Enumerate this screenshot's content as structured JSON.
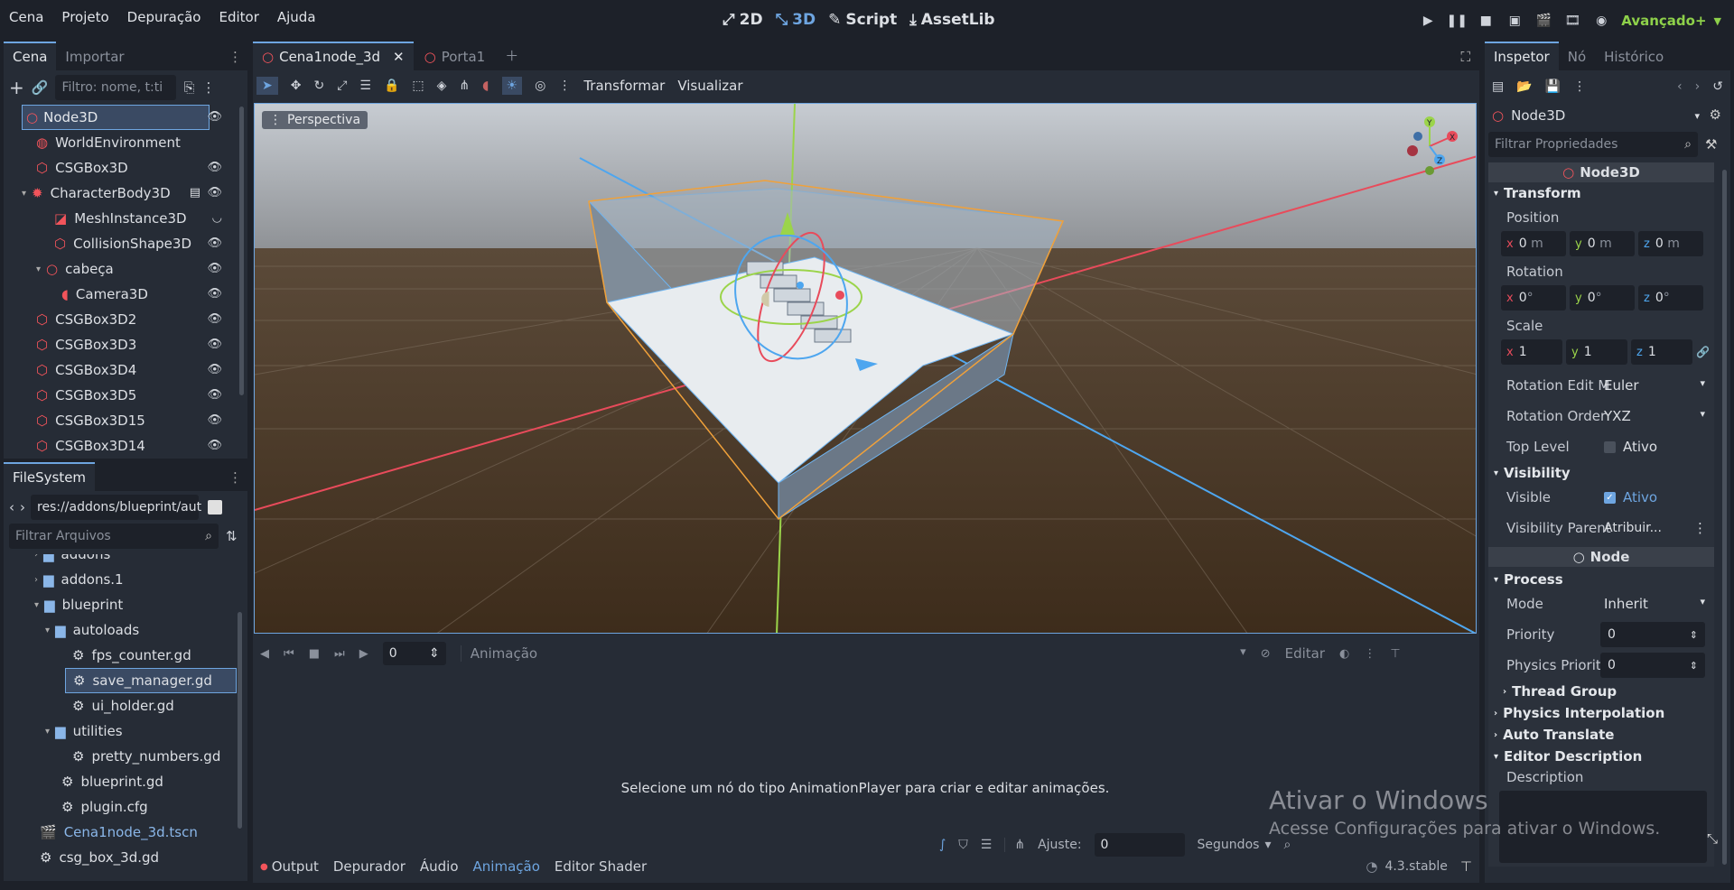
{
  "menu": [
    "Cena",
    "Projeto",
    "Depuração",
    "Editor",
    "Ajuda"
  ],
  "modes": [
    {
      "icon": "2d-icon",
      "label": "2D"
    },
    {
      "icon": "3d-icon",
      "label": "3D"
    },
    {
      "icon": "script-icon",
      "label": "Script"
    },
    {
      "icon": "assetlib-icon",
      "label": "AssetLib"
    }
  ],
  "renderer": "Avançado+",
  "scene_dock": {
    "tabs": [
      "Cena",
      "Importar"
    ],
    "filter_placeholder": "Filtro: nome, t:ti",
    "nodes": [
      {
        "name": "Node3D",
        "icon": "node3d-icon",
        "eye": true
      },
      {
        "name": "WorldEnvironment",
        "icon": "world-environment-icon",
        "eye": false
      },
      {
        "name": "CSGBox3D",
        "icon": "csg-box-icon",
        "eye": true
      },
      {
        "name": "CharacterBody3D",
        "icon": "character-body-icon",
        "eye": true
      },
      {
        "name": "MeshInstance3D",
        "icon": "mesh-instance-icon",
        "eye": true
      },
      {
        "name": "CollisionShape3D",
        "icon": "collision-shape-icon",
        "eye": true
      },
      {
        "name": "cabeça",
        "icon": "node3d-icon",
        "eye": true
      },
      {
        "name": "Camera3D",
        "icon": "camera-icon",
        "eye": true
      },
      {
        "name": "CSGBox3D2",
        "icon": "csg-box-icon",
        "eye": true
      },
      {
        "name": "CSGBox3D3",
        "icon": "csg-box-icon",
        "eye": true
      },
      {
        "name": "CSGBox3D4",
        "icon": "csg-box-icon",
        "eye": true
      },
      {
        "name": "CSGBox3D5",
        "icon": "csg-box-icon",
        "eye": true
      },
      {
        "name": "CSGBox3D15",
        "icon": "csg-box-icon",
        "eye": true
      },
      {
        "name": "CSGBox3D14",
        "icon": "csg-box-icon",
        "eye": true
      }
    ]
  },
  "filesystem": {
    "tab": "FileSystem",
    "path": "res://addons/blueprint/aut",
    "filter_placeholder": "Filtrar Arquivos",
    "items": [
      {
        "name": "addons",
        "type": "folder"
      },
      {
        "name": "addons.1",
        "type": "folder"
      },
      {
        "name": "blueprint",
        "type": "folder"
      },
      {
        "name": "autoloads",
        "type": "folder"
      },
      {
        "name": "fps_counter.gd",
        "type": "gear"
      },
      {
        "name": "save_manager.gd",
        "type": "gear"
      },
      {
        "name": "ui_holder.gd",
        "type": "gear"
      },
      {
        "name": "utilities",
        "type": "folder"
      },
      {
        "name": "pretty_numbers.gd",
        "type": "gear"
      },
      {
        "name": "blueprint.gd",
        "type": "gear"
      },
      {
        "name": "plugin.cfg",
        "type": "gear"
      },
      {
        "name": "Cena1node_3d.tscn",
        "type": "scene"
      },
      {
        "name": "csg_box_3d.gd",
        "type": "gear"
      }
    ]
  },
  "editor_tabs": [
    "Cena1node_3d",
    "Porta1"
  ],
  "viewport_toolbar": {
    "transform": "Transformar",
    "view": "Visualizar",
    "perspective": "Perspectiva"
  },
  "animation": {
    "frame": "0",
    "label": "Animação",
    "edit": "Editar",
    "message": "Selecione um nó do tipo AnimationPlayer para criar e editar animações.",
    "snap_label": "Ajuste:",
    "snap_value": "0",
    "unit": "Segundos"
  },
  "bottom_tabs": [
    "Output",
    "Depurador",
    "Áudio",
    "Animação",
    "Editor Shader"
  ],
  "version": "4.3.stable",
  "watermark": {
    "title": "Ativar o Windows",
    "sub": "Acesse Configurações para ativar o Windows."
  },
  "inspector": {
    "tabs": [
      "Inspetor",
      "Nó",
      "Histórico"
    ],
    "node": "Node3D",
    "filter_placeholder": "Filtrar Propriedades",
    "class_header": "Node3D",
    "transform": "Transform",
    "position": "Position",
    "pos": [
      "0",
      "0",
      "0"
    ],
    "pos_unit": "m",
    "rotation": "Rotation",
    "rot": [
      "0",
      "0",
      "0"
    ],
    "rot_unit": "°",
    "scale": "Scale",
    "scl": [
      "1",
      "1",
      "1"
    ],
    "rot_edit_label": "Rotation Edit M",
    "rot_edit_value": "Euler",
    "rot_order_label": "Rotation Order",
    "rot_order_value": "YXZ",
    "top_level": "Top Level",
    "ativo": "Ativo",
    "visibility": "Visibility",
    "visible": "Visible",
    "vis_parent": "Visibility Parent",
    "vis_parent_val": "Atribuir...",
    "node_header": "Node",
    "process": "Process",
    "mode": "Mode",
    "mode_val": "Inherit",
    "priority": "Priority",
    "priority_val": "0",
    "phys_priority": "Physics Priority",
    "phys_priority_val": "0",
    "thread_group": "Thread Group",
    "phys_interp": "Physics Interpolation",
    "auto_translate": "Auto Translate",
    "editor_desc": "Editor Description",
    "description": "Description"
  },
  "colors": {
    "accent": "#6ea5e0",
    "bg": "#1d2129",
    "panel": "#262c36",
    "red": "#f2545b",
    "green": "#8ed14a",
    "blue": "#5aa6f0"
  }
}
